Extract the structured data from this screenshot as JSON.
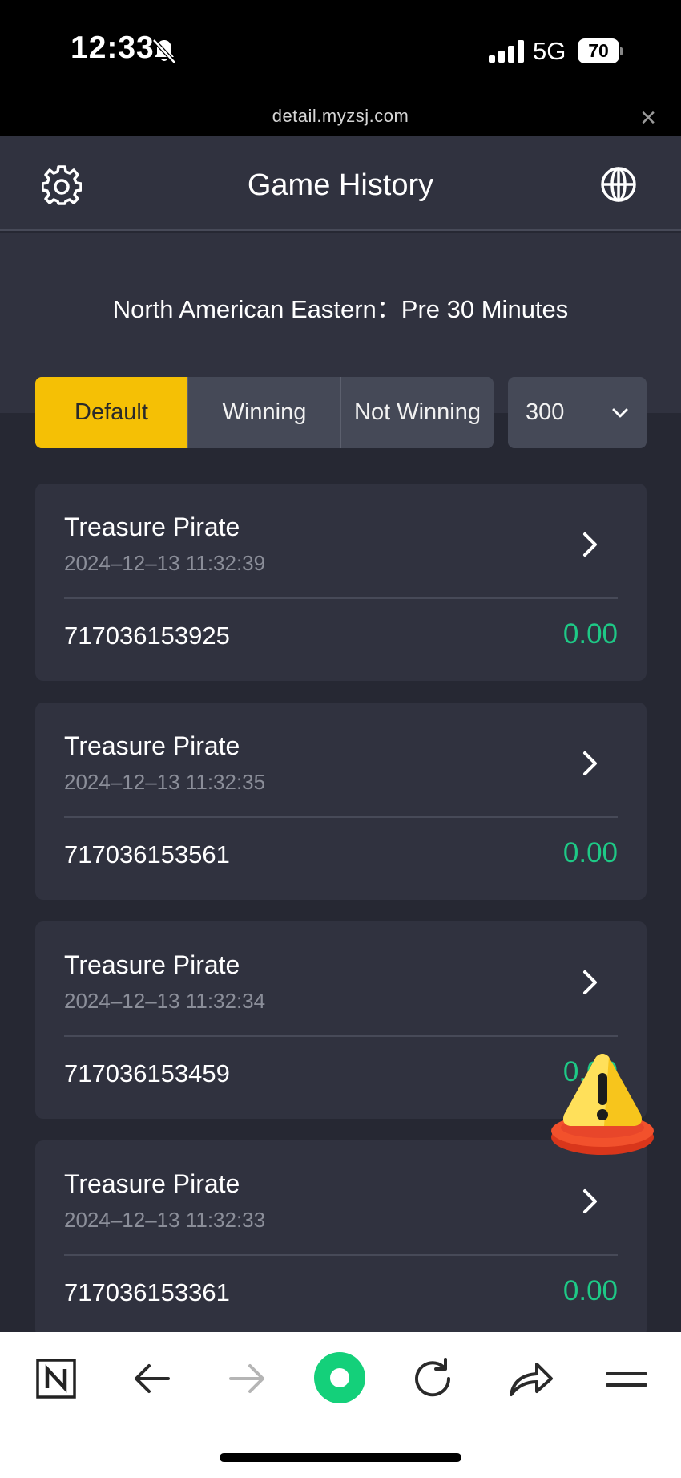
{
  "status_bar": {
    "time": "12:33",
    "network": "5G",
    "battery": "70"
  },
  "browser": {
    "url": "detail.myzsj.com",
    "close_symbol": "✕"
  },
  "header": {
    "title": "Game History"
  },
  "filter": {
    "timezone_text": "North American Eastern：Pre 30 Minutes",
    "tabs": [
      {
        "label": "Default",
        "active": true
      },
      {
        "label": "Winning",
        "active": false
      },
      {
        "label": "Not Winning",
        "active": false
      }
    ],
    "count_select": {
      "value": "300"
    }
  },
  "records": [
    {
      "game": "Treasure Pirate",
      "time": "2024–12–13 11:32:39",
      "id": "717036153925",
      "amount": "0.00"
    },
    {
      "game": "Treasure Pirate",
      "time": "2024–12–13 11:32:35",
      "id": "717036153561",
      "amount": "0.00"
    },
    {
      "game": "Treasure Pirate",
      "time": "2024–12–13 11:32:34",
      "id": "717036153459",
      "amount": "0.00"
    },
    {
      "game": "Treasure Pirate",
      "time": "2024–12–13 11:32:33",
      "id": "717036153361",
      "amount": "0.00"
    }
  ],
  "toolbar": {
    "icons": [
      "notion-icon",
      "back-arrow-icon",
      "forward-arrow-icon",
      "home-circle-icon",
      "reload-icon",
      "share-icon",
      "menu-icon"
    ]
  },
  "colors": {
    "accent_yellow": "#f5c005",
    "amount_green": "#1ec986",
    "background": "#262833",
    "card": "#30323f"
  }
}
